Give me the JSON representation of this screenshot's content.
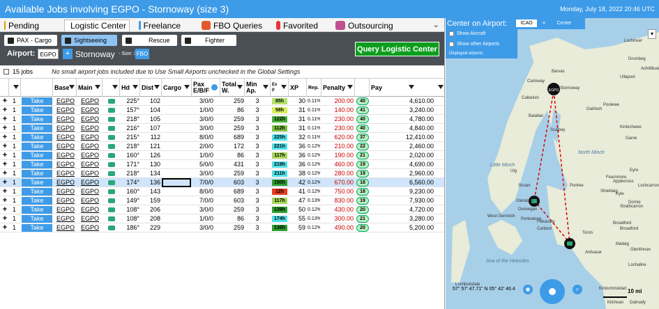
{
  "app": {
    "title": "Available Jobs involving EGPO - Stornoway (size 3)",
    "date": "Monday, July 18, 2022 20:46 UTC"
  },
  "tabs": [
    {
      "label": "Pending",
      "icon": "clock-icon",
      "color": "#d9a300"
    },
    {
      "label": "Logistic Center",
      "icon": "tools-icon",
      "color": "#888888",
      "active": true
    },
    {
      "label": "Freelance",
      "icon": "plane-icon",
      "color": "#3d9be8"
    },
    {
      "label": "FBO Queries",
      "icon": "fbo-icon",
      "color": "#e05a2a"
    },
    {
      "label": "Favorited",
      "icon": "bookmark-icon",
      "color": "#e8343a"
    },
    {
      "label": "Outsourcing",
      "icon": "people-icon",
      "color": "#c05090"
    }
  ],
  "toolbar": {
    "filters": [
      {
        "label": "PAX - Cargo",
        "active": false
      },
      {
        "label": "Sightseeing",
        "active": true
      },
      {
        "label": "Rescue",
        "active": false
      },
      {
        "label": "Fighter",
        "active": false
      }
    ],
    "airport_label": "Airport:",
    "airport_code": "EGPO",
    "airport_add": "+",
    "airport_name": "Stornoway",
    "airport_size": "- Size: 3",
    "airport_type": "FBO",
    "query_button": "Query Logistic Center"
  },
  "info": {
    "jobs_count": "15 jobs",
    "note": "No small airport jobs included due to Use Small Airports unchecked in the Global Settings"
  },
  "columns": [
    "Base",
    "Main",
    "",
    "Hd",
    "Dist",
    "Cargo",
    "Pax E/B/F",
    "Total W.",
    "Min Ap.",
    "Ex p",
    "XP",
    "Rep.",
    "Penalty",
    "",
    "Pay"
  ],
  "rows": [
    {
      "qty": "1",
      "take": "Take",
      "base": "EGPO",
      "main": "EGPO",
      "hd": "225°",
      "dist": "102",
      "cargo": "",
      "pax": "3/0/0",
      "totw": "259",
      "minap": "3",
      "exp": "85h",
      "exp_color": "#b5e26a",
      "xp": "30",
      "rep": "0.11%",
      "penalty": "200.00",
      "badge": "40",
      "pay": "4,610.00"
    },
    {
      "qty": "1",
      "take": "Take",
      "base": "EGPO",
      "main": "EGPO",
      "hd": "157°",
      "dist": "104",
      "cargo": "",
      "pax": "1/0/0",
      "totw": "86",
      "minap": "3",
      "exp": "58h",
      "exp_color": "#d6ef5a",
      "xp": "31",
      "rep": "0.11%",
      "penalty": "140.00",
      "badge": "41",
      "pay": "3,240.00"
    },
    {
      "qty": "1",
      "take": "Take",
      "base": "EGPO",
      "main": "EGPO",
      "hd": "218°",
      "dist": "105",
      "cargo": "",
      "pax": "3/0/0",
      "totw": "259",
      "minap": "3",
      "exp": "122h",
      "exp_color": "#4caf3a",
      "xp": "31",
      "rep": "0.11%",
      "penalty": "230.00",
      "badge": "40",
      "pay": "4,780.00"
    },
    {
      "qty": "1",
      "take": "Take",
      "base": "EGPO",
      "main": "EGPO",
      "hd": "216°",
      "dist": "107",
      "cargo": "",
      "pax": "3/0/0",
      "totw": "259",
      "minap": "3",
      "exp": "112h",
      "exp_color": "#7fc242",
      "xp": "31",
      "rep": "0.11%",
      "penalty": "230.00",
      "badge": "40",
      "pay": "4,840.00"
    },
    {
      "qty": "1",
      "take": "Take",
      "base": "EGPO",
      "main": "EGPO",
      "hd": "215°",
      "dist": "112",
      "cargo": "",
      "pax": "8/0/0",
      "totw": "689",
      "minap": "3",
      "exp": "225h",
      "exp_color": "#4fe0e8",
      "xp": "32",
      "rep": "0.11%",
      "penalty": "620.00",
      "badge": "37",
      "pay": "12,410.00"
    },
    {
      "qty": "1",
      "take": "Take",
      "base": "EGPO",
      "main": "EGPO",
      "hd": "218°",
      "dist": "121",
      "cargo": "",
      "pax": "2/0/0",
      "totw": "172",
      "minap": "3",
      "exp": "221h",
      "exp_color": "#4fe0e8",
      "xp": "36",
      "rep": "0.12%",
      "penalty": "210.00",
      "badge": "22",
      "pay": "2,460.00"
    },
    {
      "qty": "1",
      "take": "Take",
      "base": "EGPO",
      "main": "EGPO",
      "hd": "160°",
      "dist": "126",
      "cargo": "",
      "pax": "1/0/0",
      "totw": "86",
      "minap": "3",
      "exp": "117h",
      "exp_color": "#a8d65a",
      "xp": "36",
      "rep": "0.12%",
      "penalty": "190.00",
      "badge": "21",
      "pay": "2,020.00"
    },
    {
      "qty": "1",
      "take": "Take",
      "base": "EGPO",
      "main": "EGPO",
      "hd": "171°",
      "dist": "130",
      "cargo": "",
      "pax": "5/0/0",
      "totw": "431",
      "minap": "3",
      "exp": "219h",
      "exp_color": "#4fe0e8",
      "xp": "36",
      "rep": "0.12%",
      "penalty": "460.00",
      "badge": "19",
      "pay": "4,690.00"
    },
    {
      "qty": "1",
      "take": "Take",
      "base": "EGPO",
      "main": "EGPO",
      "hd": "218°",
      "dist": "134",
      "cargo": "",
      "pax": "3/0/0",
      "totw": "259",
      "minap": "3",
      "exp": "211h",
      "exp_color": "#4fe0e8",
      "xp": "38",
      "rep": "0.12%",
      "penalty": "280.00",
      "badge": "19",
      "pay": "2,960.00"
    },
    {
      "qty": "1",
      "take": "Take",
      "base": "EGPO",
      "main": "EGPO",
      "hd": "174°",
      "dist": "136",
      "cargo": "",
      "pax": "7/0/0",
      "totw": "603",
      "minap": "3",
      "exp": "150h",
      "exp_color": "#2e9e30",
      "xp": "42",
      "rep": "0.12%",
      "penalty": "670.00",
      "badge": "18",
      "pay": "6,560.00",
      "selected": true
    },
    {
      "qty": "1",
      "take": "Take",
      "base": "EGPO",
      "main": "EGPO",
      "hd": "160°",
      "dist": "143",
      "cargo": "",
      "pax": "8/0/0",
      "totw": "689",
      "minap": "3",
      "exp": "12h",
      "exp_color": "#e83a20",
      "xp": "41",
      "rep": "0.12%",
      "penalty": "750.00",
      "badge": "18",
      "pay": "9,230.00"
    },
    {
      "qty": "1",
      "take": "Take",
      "base": "EGPO",
      "main": "EGPO",
      "hd": "149°",
      "dist": "159",
      "cargo": "",
      "pax": "7/0/0",
      "totw": "603",
      "minap": "3",
      "exp": "117h",
      "exp_color": "#a8d65a",
      "xp": "47",
      "rep": "0.13%",
      "penalty": "830.00",
      "badge": "19",
      "pay": "7,930.00"
    },
    {
      "qty": "1",
      "take": "Take",
      "base": "EGPO",
      "main": "EGPO",
      "hd": "108°",
      "dist": "206",
      "cargo": "",
      "pax": "3/0/0",
      "totw": "259",
      "minap": "3",
      "exp": "139h",
      "exp_color": "#2e9e30",
      "xp": "50",
      "rep": "0.12%",
      "penalty": "430.00",
      "badge": "20",
      "pay": "4,720.00"
    },
    {
      "qty": "1",
      "take": "Take",
      "base": "EGPO",
      "main": "EGPO",
      "hd": "108°",
      "dist": "208",
      "cargo": "",
      "pax": "1/0/0",
      "totw": "86",
      "minap": "3",
      "exp": "174h",
      "exp_color": "#4fe0e8",
      "xp": "55",
      "rep": "0.13%",
      "penalty": "300.00",
      "badge": "21",
      "pay": "3,280.00"
    },
    {
      "qty": "1",
      "take": "Take",
      "base": "EGPO",
      "main": "EGPO",
      "hd": "186°",
      "dist": "229",
      "cargo": "",
      "pax": "3/0/0",
      "totw": "259",
      "minap": "3",
      "exp": "138h",
      "exp_color": "#2e9e30",
      "xp": "59",
      "rep": "0.12%",
      "penalty": "490.00",
      "badge": "20",
      "pay": "5,200.00"
    }
  ],
  "map": {
    "title": "Center on Airport:",
    "code": "ICAO",
    "plus": "+",
    "center": "Center",
    "show_aircraft": "Show Aircraft",
    "show_other_airports": "Show other Airports",
    "displayed": "Displayed airports:",
    "coord": "57° 57' 47.71\" N 05° 42' 46.4",
    "scale": "10 mi",
    "places": [
      "Barvas",
      "Stornoway",
      "Carloway",
      "Callanish",
      "Balallan",
      "Gairloch",
      "Poolewe",
      "Ullapool",
      "Drumbeg",
      "Lochinver",
      "Achiltibuie",
      "Scalpay",
      "Portree",
      "Dunvegan",
      "Glendale",
      "Fiskavaig",
      "Carbost",
      "Kinlochewe",
      "Garve",
      "Fearnmore",
      "Applecross",
      "Torrin",
      "Broadford",
      "Shieldaig",
      "Kyle",
      "Dornie",
      "Lochcarron",
      "Strathcarron",
      "Ardvasar",
      "Glenfinnan",
      "Kinlochmoidart",
      "Kilchoan",
      "Lochaline",
      "Mallaig",
      "Struan",
      "West Gerrinish",
      "Lochboisdale",
      "Portnalong",
      "Uig",
      "Eyre",
      "Broadford",
      "Dalmally"
    ],
    "seas": [
      "North Minch",
      "Little Minch",
      "Sea of the Hebrides"
    ]
  }
}
